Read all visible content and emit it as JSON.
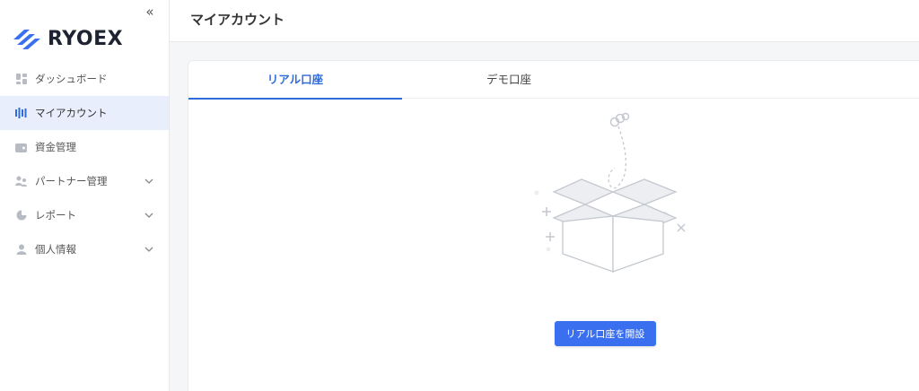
{
  "sidebar": {
    "brand": "RYOEX",
    "collapse_icon": "double-chevron-left-icon",
    "items": [
      {
        "label": "ダッシュボード",
        "icon": "dashboard-icon",
        "has_submenu": false,
        "active": false
      },
      {
        "label": "マイアカウント",
        "icon": "account-icon",
        "has_submenu": false,
        "active": true
      },
      {
        "label": "資金管理",
        "icon": "wallet-icon",
        "has_submenu": false,
        "active": false
      },
      {
        "label": "パートナー管理",
        "icon": "partners-icon",
        "has_submenu": true,
        "active": false
      },
      {
        "label": "レポート",
        "icon": "pie-chart-icon",
        "has_submenu": true,
        "active": false
      },
      {
        "label": "個人情報",
        "icon": "user-icon",
        "has_submenu": true,
        "active": false
      }
    ]
  },
  "header": {
    "title": "マイアカウント"
  },
  "main": {
    "tabs": [
      {
        "label": "リアル口座",
        "active": true
      },
      {
        "label": "デモ口座",
        "active": false
      }
    ],
    "empty_state_icon": "empty-box-icon",
    "open_button_label": "リアル口座を開設"
  },
  "colors": {
    "accent": "#2f6bd9",
    "button": "#3a6ff0",
    "active_nav_bg": "#e8eefc",
    "brand_blue": "#3a6ff0"
  }
}
